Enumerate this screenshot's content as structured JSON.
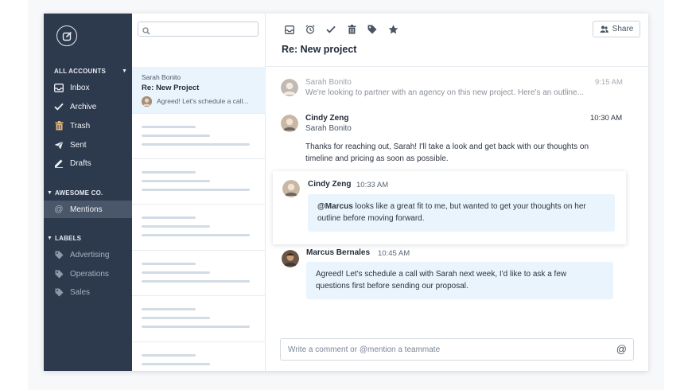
{
  "sidebar": {
    "accounts_header": "ALL ACCOUNTS",
    "items": [
      {
        "label": "Inbox",
        "icon": "inbox-icon"
      },
      {
        "label": "Archive",
        "icon": "check-icon"
      },
      {
        "label": "Trash",
        "icon": "trash-icon"
      },
      {
        "label": "Sent",
        "icon": "send-icon"
      },
      {
        "label": "Drafts",
        "icon": "pencil-icon"
      }
    ],
    "team_header": "AWESOME CO.",
    "mentions_label": "Mentions",
    "labels_header": "LABELS",
    "labels": [
      {
        "label": "Advertising",
        "icon": "tag-icon"
      },
      {
        "label": "Operations",
        "icon": "tag-icon"
      },
      {
        "label": "Sales",
        "icon": "tag-icon"
      }
    ]
  },
  "list": {
    "search_placeholder": "",
    "selected": {
      "from": "Sarah Bonito",
      "subject": "Re:  New Project",
      "snippet": "Agreed! Let's schedule a call..."
    }
  },
  "main": {
    "share_label": "Share",
    "title": "Re: New project",
    "messages": [
      {
        "name": "Sarah Bonito",
        "time": "9:15 AM",
        "preview": "We're looking to partner with an agency on this new project. Here's an outline..."
      },
      {
        "name": "Cindy Zeng",
        "to": "Sarah Bonito",
        "time": "10:30 AM",
        "body_line1": "Thanks for reaching out, Sarah! I'll take a look and get back with our thoughts on",
        "body_line2": "timeline and pricing as soon as possible."
      }
    ],
    "comments": [
      {
        "name": "Cindy Zeng",
        "time": "10:33 AM",
        "mention": "@Marcus",
        "text_line1_rest": " looks like a great fit to me, but wanted to get your thoughts on her",
        "text_line2": "outline before moving forward."
      },
      {
        "name": "Marcus Bernales",
        "time": "10:45 AM",
        "text_line1": "Agreed! Let's schedule a call with Sarah next week, I'd like to ask a few",
        "text_line2": "questions first before sending our proposal."
      }
    ],
    "comment_placeholder": "Write a comment or @mention a teammate"
  },
  "colors": {
    "sidebar_bg": "#2d394d",
    "highlight": "#e9f4fd",
    "placeholder_bar": "#d3dbe5"
  }
}
